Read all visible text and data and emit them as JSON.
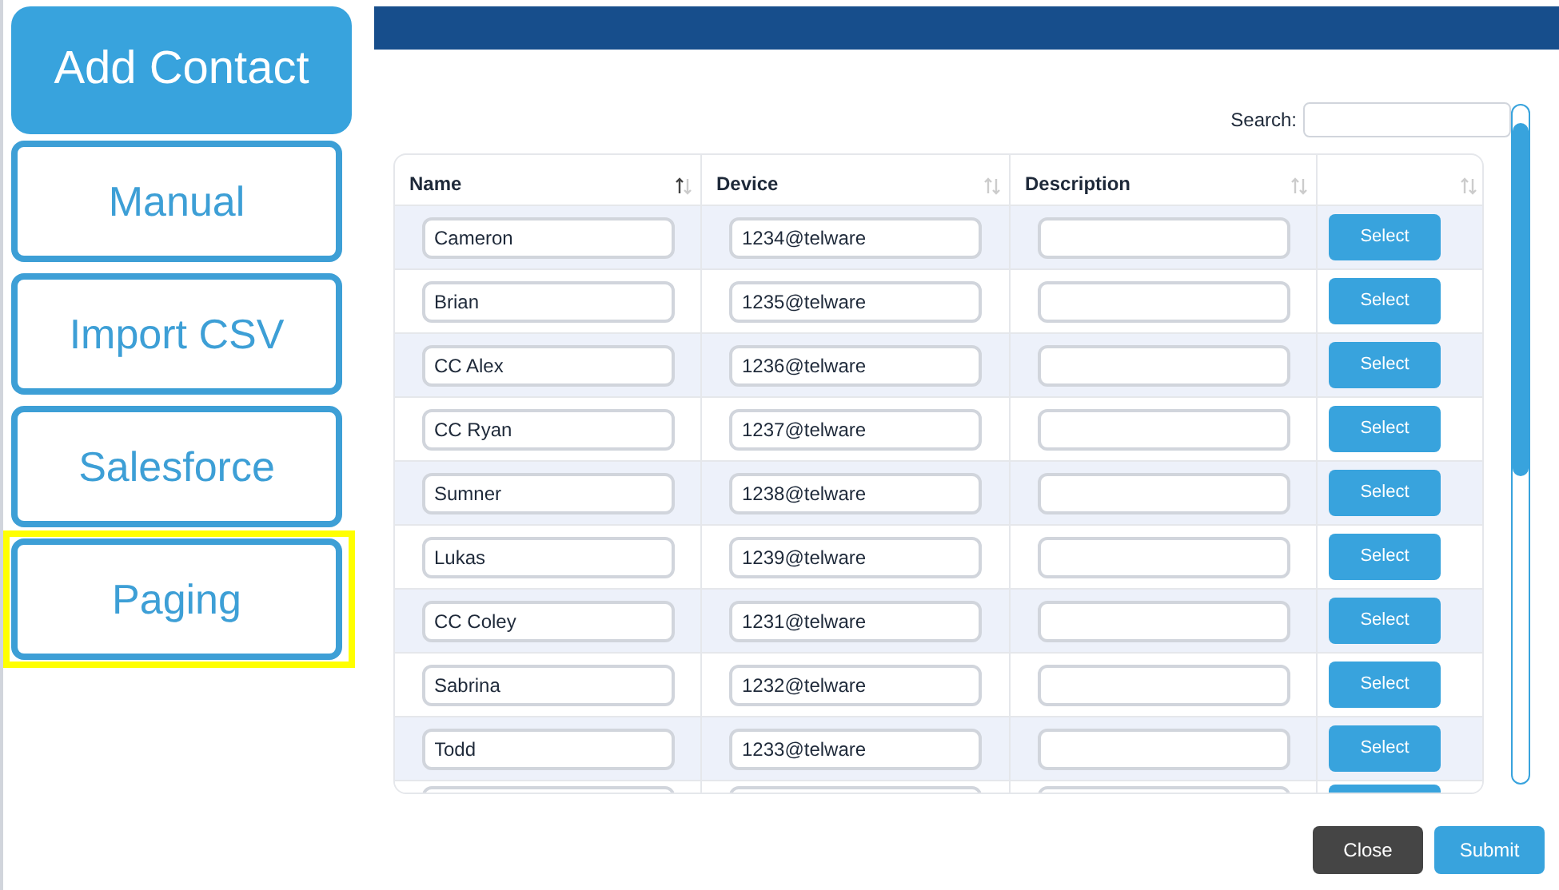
{
  "sidebar": {
    "title": "Add Contact",
    "items": [
      {
        "label": "Manual",
        "highlighted": false
      },
      {
        "label": "Import CSV",
        "highlighted": false
      },
      {
        "label": "Salesforce",
        "highlighted": false
      },
      {
        "label": "Paging",
        "highlighted": true
      }
    ]
  },
  "search": {
    "label": "Search:"
  },
  "table": {
    "columns": [
      {
        "label": "Name",
        "sorted": true
      },
      {
        "label": "Device",
        "sorted": false
      },
      {
        "label": "Description",
        "sorted": false
      },
      {
        "sorted": false
      }
    ],
    "rows": [
      {
        "name": "Cameron",
        "device": "1234@telware",
        "action": "Select"
      },
      {
        "name": "Brian",
        "device": "1235@telware",
        "action": "Select"
      },
      {
        "name": "CC Alex",
        "device": "1236@telware",
        "action": "Select"
      },
      {
        "name": "CC Ryan",
        "device": "1237@telware",
        "action": "Select"
      },
      {
        "name": "Sumner",
        "device": "1238@telware",
        "action": "Select"
      },
      {
        "name": "Lukas",
        "device": "1239@telware",
        "action": "Select"
      },
      {
        "name": "CC Coley",
        "device": "1231@telware",
        "action": "Select"
      },
      {
        "name": "Sabrina",
        "device": "1232@telware",
        "action": "Select"
      },
      {
        "name": "Todd",
        "device": "1233@telware",
        "action": "Select"
      }
    ],
    "partial_row": true
  },
  "buttons": [
    {
      "label": "Close",
      "kind": "secondary"
    },
    {
      "label": "Submit",
      "kind": "primary"
    }
  ]
}
